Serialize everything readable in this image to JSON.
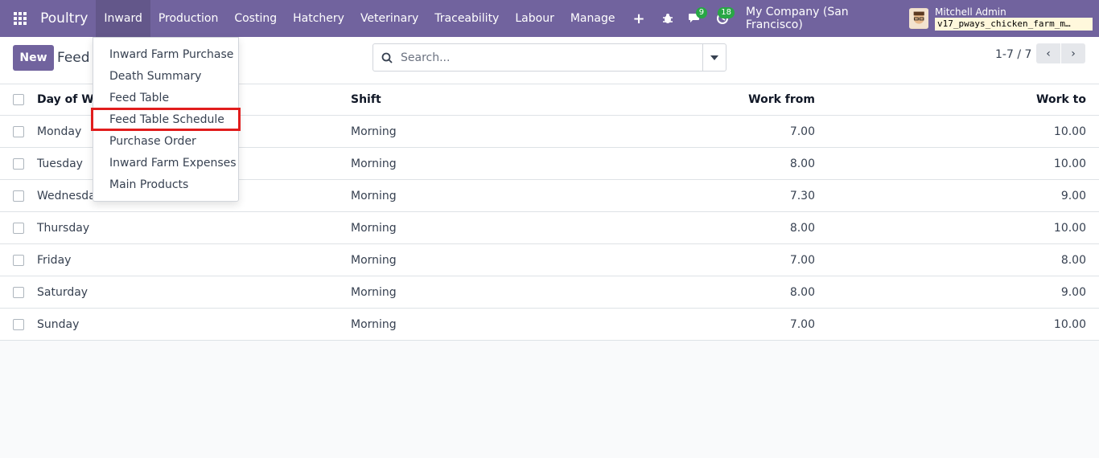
{
  "navbar": {
    "app_name": "Poultry",
    "menu": [
      "Inward",
      "Production",
      "Costing",
      "Hatchery",
      "Veterinary",
      "Traceability",
      "Labour",
      "Manage"
    ],
    "plus": "+",
    "messages_badge": "9",
    "activities_badge": "18",
    "company": "My Company (San Francisco)",
    "user_name": "Mitchell Admin",
    "db_name": "v17_pways_chicken_farm_m…",
    "badge_color": "#28a745",
    "brand_color": "#71639e"
  },
  "control": {
    "new_label": "New",
    "breadcrumb": "Feed T",
    "search_placeholder": "Search...",
    "pager_value": "1-7 / 7",
    "prev": "‹",
    "next": "›"
  },
  "dropdown": {
    "items": [
      "Inward Farm Purchase",
      "Death Summary",
      "Feed Table",
      "Feed Table Schedule",
      "Purchase Order",
      "Inward Farm Expenses",
      "Main Products"
    ],
    "highlighted": "Feed Table Schedule"
  },
  "table": {
    "headers": {
      "day": "Day of Week",
      "shift": "Shift",
      "from": "Work from",
      "to": "Work to"
    },
    "rows": [
      {
        "day": "Monday",
        "shift": "Morning",
        "from": "7.00",
        "to": "10.00"
      },
      {
        "day": "Tuesday",
        "shift": "Morning",
        "from": "8.00",
        "to": "10.00"
      },
      {
        "day": "Wednesday",
        "shift": "Morning",
        "from": "7.30",
        "to": "9.00"
      },
      {
        "day": "Thursday",
        "shift": "Morning",
        "from": "8.00",
        "to": "10.00"
      },
      {
        "day": "Friday",
        "shift": "Morning",
        "from": "7.00",
        "to": "8.00"
      },
      {
        "day": "Saturday",
        "shift": "Morning",
        "from": "8.00",
        "to": "9.00"
      },
      {
        "day": "Sunday",
        "shift": "Morning",
        "from": "7.00",
        "to": "10.00"
      }
    ]
  }
}
